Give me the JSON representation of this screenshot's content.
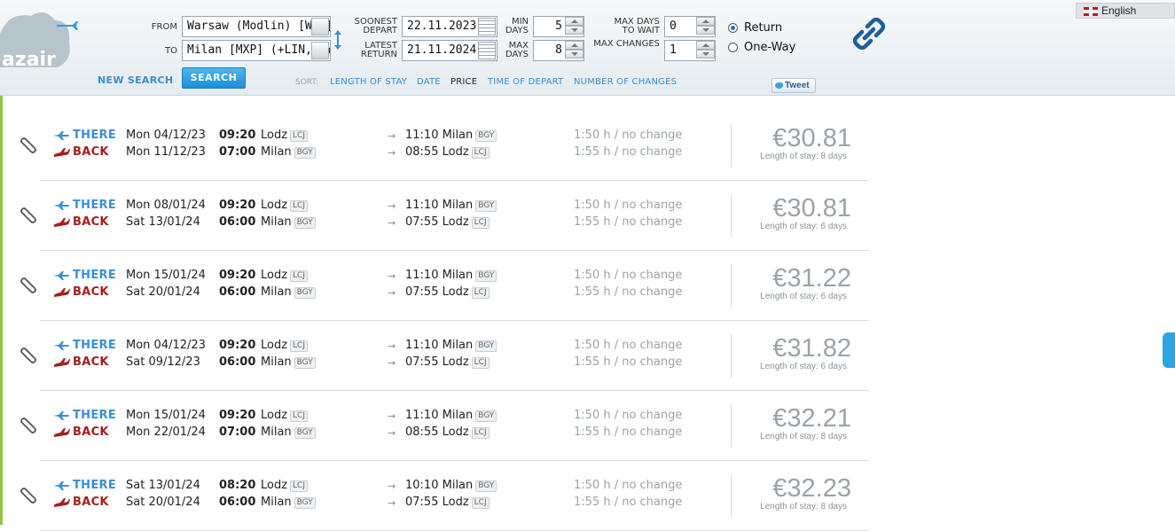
{
  "language": "English",
  "logo_text": "azair",
  "search": {
    "from_label": "FROM",
    "to_label": "TO",
    "from_value": "Warsaw (Modlin) [WMI]",
    "to_value": "Milan [MXP] (+LIN,BGY)",
    "soonest_depart_label_1": "SOONEST",
    "soonest_depart_label_2": "DEPART",
    "soonest_depart_value": "22.11.2023",
    "latest_return_label_1": "LATEST",
    "latest_return_label_2": "RETURN",
    "latest_return_value": "21.11.2024",
    "min_days_label_1": "MIN",
    "min_days_label_2": "DAYS",
    "min_days_value": "5",
    "max_days_label_1": "MAX",
    "max_days_label_2": "DAYS",
    "max_days_value": "8",
    "max_wait_label_1": "MAX DAYS",
    "max_wait_label_2": "TO WAIT",
    "max_wait_value": "0",
    "max_changes_label": "MAX CHANGES",
    "max_changes_value": "1",
    "trip_types": [
      "Return",
      "One-Way"
    ],
    "selected_trip_type": "Return",
    "new_search": "NEW SEARCH",
    "search_button": "SEARCH"
  },
  "sort": {
    "label": "SORT:",
    "options": [
      "LENGTH OF STAY",
      "DATE",
      "PRICE",
      "TIME OF DEPART",
      "NUMBER OF CHANGES"
    ],
    "active": "PRICE"
  },
  "tweet_label": "Tweet",
  "results": [
    {
      "there": {
        "label": "THERE",
        "date": "Mon 04/12/23",
        "dep_time": "09:20",
        "dep_city": "Lodz",
        "dep_code": "LCJ",
        "arr_time": "11:10",
        "arr_city": "Milan",
        "arr_code": "BGY",
        "duration": "1:50 h / no change"
      },
      "back": {
        "label": "BACK",
        "date": "Mon 11/12/23",
        "dep_time": "07:00",
        "dep_city": "Milan",
        "dep_code": "BGY",
        "arr_time": "08:55",
        "arr_city": "Lodz",
        "arr_code": "LCJ",
        "duration": "1:55 h / no change"
      },
      "price": "€30.81",
      "stay": "Length of stay: 8 days"
    },
    {
      "there": {
        "label": "THERE",
        "date": "Mon 08/01/24",
        "dep_time": "09:20",
        "dep_city": "Lodz",
        "dep_code": "LCJ",
        "arr_time": "11:10",
        "arr_city": "Milan",
        "arr_code": "BGY",
        "duration": "1:50 h / no change"
      },
      "back": {
        "label": "BACK",
        "date": "Sat 13/01/24",
        "dep_time": "06:00",
        "dep_city": "Milan",
        "dep_code": "BGY",
        "arr_time": "07:55",
        "arr_city": "Lodz",
        "arr_code": "LCJ",
        "duration": "1:55 h / no change"
      },
      "price": "€30.81",
      "stay": "Length of stay: 6 days"
    },
    {
      "there": {
        "label": "THERE",
        "date": "Mon 15/01/24",
        "dep_time": "09:20",
        "dep_city": "Lodz",
        "dep_code": "LCJ",
        "arr_time": "11:10",
        "arr_city": "Milan",
        "arr_code": "BGY",
        "duration": "1:50 h / no change"
      },
      "back": {
        "label": "BACK",
        "date": "Sat 20/01/24",
        "dep_time": "06:00",
        "dep_city": "Milan",
        "dep_code": "BGY",
        "arr_time": "07:55",
        "arr_city": "Lodz",
        "arr_code": "LCJ",
        "duration": "1:55 h / no change"
      },
      "price": "€31.22",
      "stay": "Length of stay: 6 days"
    },
    {
      "there": {
        "label": "THERE",
        "date": "Mon 04/12/23",
        "dep_time": "09:20",
        "dep_city": "Lodz",
        "dep_code": "LCJ",
        "arr_time": "11:10",
        "arr_city": "Milan",
        "arr_code": "BGY",
        "duration": "1:50 h / no change"
      },
      "back": {
        "label": "BACK",
        "date": "Sat 09/12/23",
        "dep_time": "06:00",
        "dep_city": "Milan",
        "dep_code": "BGY",
        "arr_time": "07:55",
        "arr_city": "Lodz",
        "arr_code": "LCJ",
        "duration": "1:55 h / no change"
      },
      "price": "€31.82",
      "stay": "Length of stay: 6 days"
    },
    {
      "there": {
        "label": "THERE",
        "date": "Mon 15/01/24",
        "dep_time": "09:20",
        "dep_city": "Lodz",
        "dep_code": "LCJ",
        "arr_time": "11:10",
        "arr_city": "Milan",
        "arr_code": "BGY",
        "duration": "1:50 h / no change"
      },
      "back": {
        "label": "BACK",
        "date": "Mon 22/01/24",
        "dep_time": "07:00",
        "dep_city": "Milan",
        "dep_code": "BGY",
        "arr_time": "08:55",
        "arr_city": "Lodz",
        "arr_code": "LCJ",
        "duration": "1:55 h / no change"
      },
      "price": "€32.21",
      "stay": "Length of stay: 8 days"
    },
    {
      "there": {
        "label": "THERE",
        "date": "Sat 13/01/24",
        "dep_time": "08:20",
        "dep_city": "Lodz",
        "dep_code": "LCJ",
        "arr_time": "10:10",
        "arr_city": "Milan",
        "arr_code": "BGY",
        "duration": "1:50 h / no change"
      },
      "back": {
        "label": "BACK",
        "date": "Sat 20/01/24",
        "dep_time": "06:00",
        "dep_city": "Milan",
        "dep_code": "BGY",
        "arr_time": "07:55",
        "arr_city": "Lodz",
        "arr_code": "LCJ",
        "duration": "1:55 h / no change"
      },
      "price": "€32.23",
      "stay": "Length of stay: 8 days"
    }
  ],
  "colors": {
    "accent": "#3b8ed6",
    "back": "#a61e1e",
    "green_edge": "#8dc63f",
    "price": "#9aa3a9"
  }
}
